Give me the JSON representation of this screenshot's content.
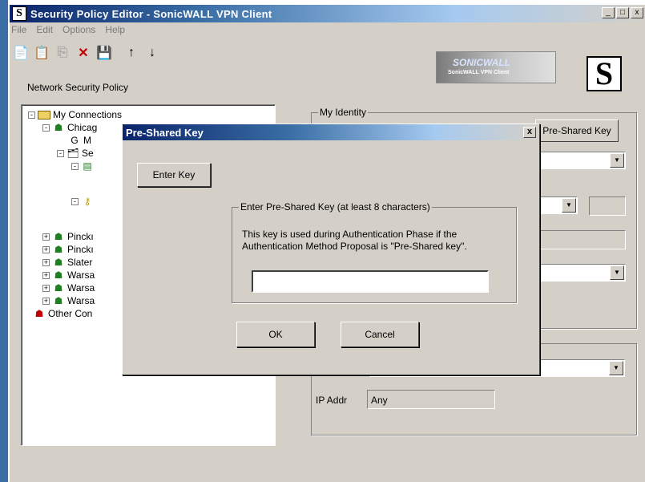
{
  "window": {
    "title": "Security Policy Editor - SonicWALL VPN Client",
    "minimize": "_",
    "maximize": "□",
    "close": "x"
  },
  "menu": [
    "File",
    "Edit",
    "Options",
    "Help"
  ],
  "toolbar_label": "Network Security Policy",
  "branding": {
    "sonicwall": "SONICWALL",
    "sub": "SonicWALL VPN Client",
    "s": "S"
  },
  "tree": {
    "root": "My Connections",
    "items": [
      {
        "label": "Chicag",
        "icon": "network-icon"
      },
      {
        "label": "M",
        "icon": "identity-icon"
      },
      {
        "label": "Se",
        "icon": "folder-icon"
      },
      {
        "label": "",
        "icon": "proposal-icon"
      },
      {
        "label": "",
        "icon": "key-icon"
      },
      {
        "label": "Pinckı",
        "icon": "network-icon"
      },
      {
        "label": "Pinckı",
        "icon": "network-icon"
      },
      {
        "label": "Slater",
        "icon": "network-icon"
      },
      {
        "label": "Warsa",
        "icon": "network-icon"
      },
      {
        "label": "Warsa",
        "icon": "network-icon"
      },
      {
        "label": "Warsa",
        "icon": "network-icon"
      },
      {
        "label": "Other Con",
        "icon": "network-icon"
      }
    ]
  },
  "identity": {
    "label": "My Identity",
    "psk_button": "Pre-Shared Key"
  },
  "ip": {
    "label": "IP Addr",
    "value": "Any"
  },
  "dialog": {
    "title": "Pre-Shared Key",
    "close": "x",
    "enter_key_button": "Enter Key",
    "group_label": "Enter Pre-Shared Key (at least 8 characters)",
    "description": "This key is used during Authentication Phase if the Authentication Method Proposal is \"Pre-Shared key\".",
    "key_value": "",
    "ok": "OK",
    "cancel": "Cancel"
  }
}
